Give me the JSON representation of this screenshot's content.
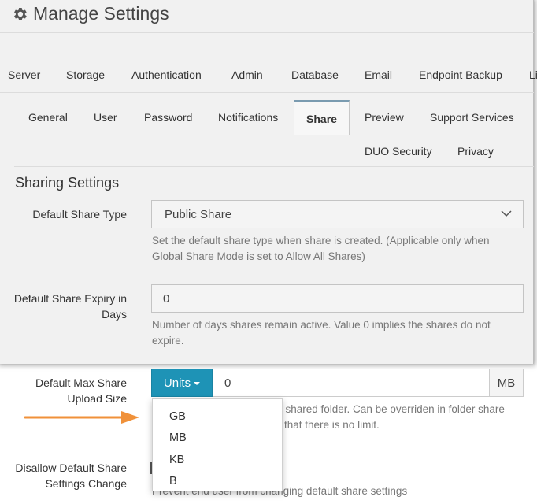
{
  "header": {
    "title": "Manage Settings",
    "icon": "gear-icon"
  },
  "main_tabs": [
    "Server",
    "Storage",
    "Authentication",
    "Admin",
    "Database",
    "Email",
    "Endpoint Backup",
    "Li"
  ],
  "sub_tabs": {
    "row1": [
      "General",
      "User",
      "Password",
      "Notifications",
      "Share",
      "Preview",
      "Support Services"
    ],
    "row2": [
      "DUO Security",
      "Privacy"
    ],
    "active": "Share"
  },
  "section": {
    "title": "Sharing Settings"
  },
  "fields": {
    "share_type": {
      "label": "Default Share Type",
      "value": "Public Share",
      "help_line1": "Set the default share type when share is created. (Applicable only when",
      "help_line2": "Global Share Mode is set to Allow All Shares)"
    },
    "expiry": {
      "label_line1": "Default Share Expiry in",
      "label_line2": "Days",
      "value": "0",
      "help_line1": "Number of days shares remain active. Value 0 implies the shares do not",
      "help_line2": "expire."
    },
    "max_size": {
      "label_line1": "Default Max Share",
      "label_line2": "Upload Size",
      "units_button": "Units",
      "value": "0",
      "addon": "MB",
      "help_line1_visible": "r a shared folder. Can be overriden in folder share",
      "help_line2_visible": "es that there is no limit."
    },
    "disallow": {
      "label_line1": "Disallow Default Share",
      "label_line2": "Settings Change",
      "help_visible": "Prevent end user from changing default share settings"
    }
  },
  "units_menu": {
    "options": [
      "GB",
      "MB",
      "KB",
      "B"
    ]
  },
  "colors": {
    "accent": "#1e93b6",
    "arrow": "#f0913a",
    "dim_overlay": "#f1f1f1"
  }
}
